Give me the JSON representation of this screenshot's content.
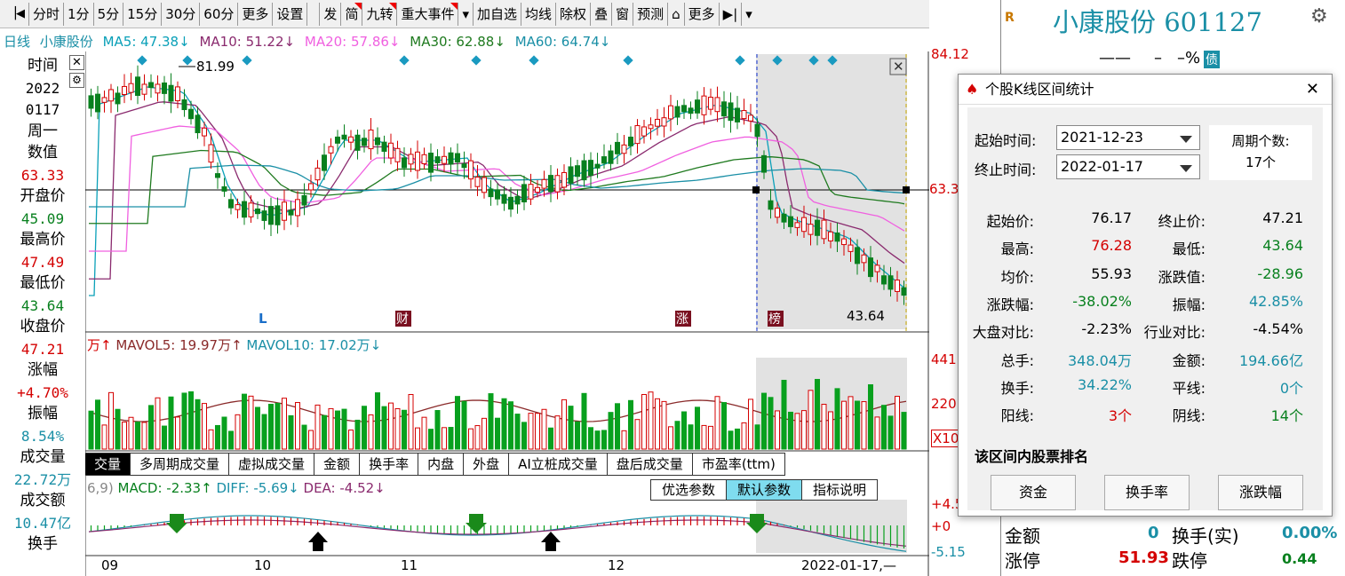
{
  "toolbar": {
    "items": [
      "分时",
      "1分",
      "5分",
      "15分",
      "30分",
      "60分",
      "更多",
      "设置",
      "发",
      "简",
      "九转",
      "重大事件",
      "加自选",
      "均线",
      "除权",
      "叠",
      "窗",
      "预测",
      "更多"
    ]
  },
  "ma_line": {
    "period": "日线",
    "name": "小康股份",
    "ma5": "MA5: 47.38↓",
    "ma10": "MA10: 51.22↓",
    "ma20": "MA20: 57.86↓",
    "ma30": "MA30: 62.88↓",
    "ma60": "MA60: 64.74↓"
  },
  "left_panel": {
    "time_label": "时间",
    "date1": "2022",
    "date2": "0117",
    "weekday": "周一",
    "value_label": "数值",
    "value": "63.33",
    "open_label": "开盘价",
    "open": "45.09",
    "high_label": "最高价",
    "high": "47.49",
    "low_label": "最低价",
    "low": "43.64",
    "close_label": "收盘价",
    "close": "47.21",
    "change_label": "涨幅",
    "change": "+4.70%",
    "amp_label": "振幅",
    "amp": "8.54%",
    "vol_label": "成交量",
    "vol": "22.72万",
    "amount_label": "成交额",
    "amount": "10.47亿",
    "turnover_label": "换手"
  },
  "chart_labels": {
    "high_mark": "81.99",
    "low_mark": "43.64",
    "marker_l": "L",
    "marker_cai": "财",
    "marker_zhang": "涨",
    "marker_bang": "榜",
    "x_months": [
      "09",
      "10",
      "11",
      "12"
    ],
    "x_end": "2022-01-17,—"
  },
  "right_axis": {
    "top": "84.12",
    "cur": "63.3",
    "vol_top": "441",
    "vol_mid": "220",
    "vol_unit": "X10",
    "macd_top": "+4.5",
    "macd_zero": "+0",
    "macd_bot": "-5.15"
  },
  "vol_line": {
    "prefix": "万↑",
    "mavol5": "MAVOL5: 19.97万↑",
    "mavol10": "MAVOL10: 17.02万↓"
  },
  "tabs": [
    "交量",
    "多周期成交量",
    "虚拟成交量",
    "金额",
    "换手率",
    "内盘",
    "外盘",
    "AI立桩成交量",
    "盘后成交量",
    "市盈率(ttm)"
  ],
  "macd_line": {
    "prefix": "6,9)",
    "macd": "MACD: -2.33↑",
    "diff": "DIFF: -5.69↓",
    "dea": "DEA: -4.52↓"
  },
  "params": [
    "优选参数",
    "默认参数",
    "指标说明"
  ],
  "stock_panel": {
    "badge": "R",
    "title": "小康股份  601127",
    "dash1": "——",
    "dash2": "–",
    "pct": "–%",
    "debt": "债",
    "amount_label": "金额",
    "amount_val": "0",
    "turn_label": "换手(实)",
    "turn_val": "0.00%",
    "limit_up_label": "涨停",
    "limit_up_val": "51.93",
    "limit_down_label": "跌停",
    "frac": "0.44"
  },
  "dialog": {
    "title": "个股K线区间统计",
    "start_label": "起始时间:",
    "start_date": "2021-12-23",
    "end_label": "终止时间:",
    "end_date": "2022-01-17",
    "period_label": "周期个数:",
    "period_count": "17个",
    "stats": [
      {
        "l1": "起始价:",
        "v1": "76.17",
        "c1": "black",
        "l2": "终止价:",
        "v2": "47.21",
        "c2": "black"
      },
      {
        "l1": "最高:",
        "v1": "76.28",
        "c1": "red",
        "l2": "最低:",
        "v2": "43.64",
        "c2": "green"
      },
      {
        "l1": "均价:",
        "v1": "55.93",
        "c1": "black",
        "l2": "涨跌值:",
        "v2": "-28.96",
        "c2": "green"
      },
      {
        "l1": "涨跌幅:",
        "v1": "-38.02%",
        "c1": "green",
        "l2": "振幅:",
        "v2": "42.85%",
        "c2": "cyan"
      },
      {
        "l1": "大盘对比:",
        "v1": "-2.23%",
        "c1": "black",
        "l2": "行业对比:",
        "v2": "-4.54%",
        "c2": "black"
      },
      {
        "l1": "总手:",
        "v1": "348.04万",
        "c1": "cyan",
        "l2": "金额:",
        "v2": "194.66亿",
        "c2": "cyan"
      },
      {
        "l1": "换手:",
        "v1": "34.22%",
        "c1": "cyan",
        "l2": "平线:",
        "v2": "0个",
        "c2": "cyan"
      },
      {
        "l1": "阳线:",
        "v1": "3个",
        "c1": "red",
        "l2": "阴线:",
        "v2": "14个",
        "c2": "green"
      }
    ],
    "rank_label": "该区间内股票排名",
    "btn_capital": "资金",
    "btn_turnover": "换手率",
    "btn_change": "涨跌幅"
  }
}
